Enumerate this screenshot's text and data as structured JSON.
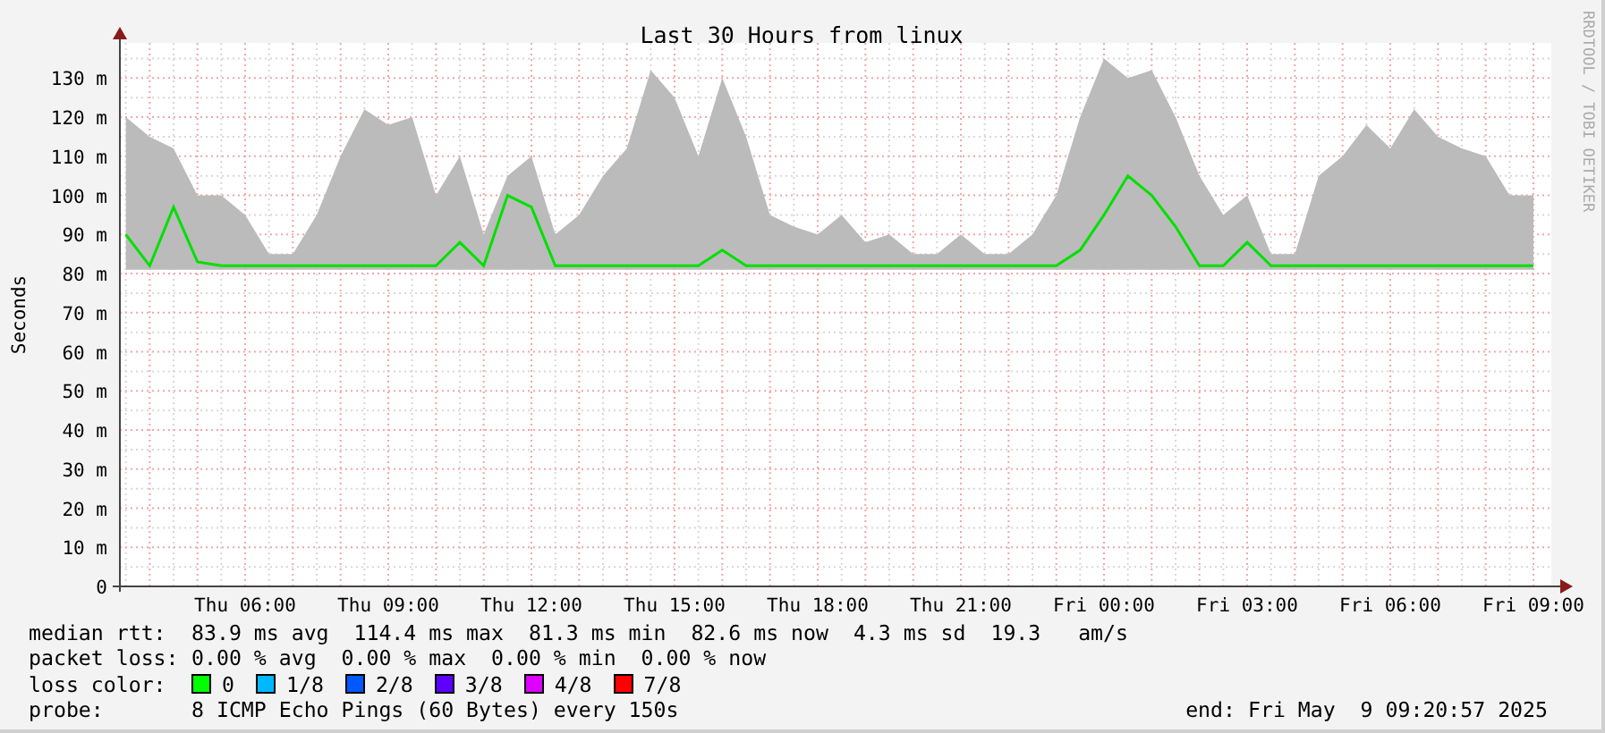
{
  "chart": {
    "watermark": "RRDTOOL / TOBI OETIKER",
    "chart_data": {
      "type": "line",
      "title": "Last 30 Hours from linux",
      "ylabel": "Seconds",
      "categories": [
        null,
        null,
        null,
        null,
        null,
        "Thu 06:00",
        null,
        null,
        null,
        null,
        null,
        "Thu 09:00",
        null,
        null,
        null,
        null,
        null,
        "Thu 12:00",
        null,
        null,
        null,
        null,
        null,
        "Thu 15:00",
        null,
        null,
        null,
        null,
        null,
        "Thu 18:00",
        null,
        null,
        null,
        null,
        null,
        "Thu 21:00",
        null,
        null,
        null,
        null,
        null,
        "Fri 00:00",
        null,
        null,
        null,
        null,
        null,
        "Fri 03:00",
        null,
        null,
        null,
        null,
        null,
        "Fri 06:00",
        null,
        null,
        null,
        null,
        null,
        "Fri 09:00"
      ],
      "ylim": [
        0,
        139
      ],
      "grid": true,
      "yticks": [
        {
          "value": 0,
          "label": "0"
        },
        {
          "value": 10,
          "label": "10 m"
        },
        {
          "value": 20,
          "label": "20 m"
        },
        {
          "value": 30,
          "label": "30 m"
        },
        {
          "value": 40,
          "label": "40 m"
        },
        {
          "value": 50,
          "label": "50 m"
        },
        {
          "value": 60,
          "label": "60 m"
        },
        {
          "value": 70,
          "label": "70 m"
        },
        {
          "value": 80,
          "label": "80 m"
        },
        {
          "value": 90,
          "label": "90 m"
        },
        {
          "value": 100,
          "label": "100 m"
        },
        {
          "value": 110,
          "label": "110 m"
        },
        {
          "value": 120,
          "label": "120 m"
        },
        {
          "value": 130,
          "label": "130 m"
        }
      ],
      "series": [
        {
          "type": "area",
          "color": "#bbbbbb",
          "values": [
            120,
            115,
            112,
            100,
            100,
            95,
            85,
            85,
            95,
            110,
            122,
            118,
            120,
            100,
            110,
            90,
            105,
            110,
            90,
            95,
            105,
            112,
            132,
            125,
            110,
            130,
            115,
            95,
            92,
            90,
            95,
            88,
            90,
            85,
            85,
            90,
            85,
            85,
            90,
            100,
            120,
            135,
            130,
            132,
            120,
            105,
            95,
            100,
            85,
            85,
            105,
            110,
            118,
            112,
            122,
            115,
            112,
            110,
            100,
            100
          ]
        },
        {
          "type": "line",
          "color": "#00e000",
          "values": [
            90,
            82,
            97,
            83,
            82,
            82,
            82,
            82,
            82,
            82,
            82,
            82,
            82,
            82,
            88,
            82,
            100,
            97,
            82,
            82,
            82,
            82,
            82,
            82,
            82,
            86,
            82,
            82,
            82,
            82,
            82,
            82,
            82,
            82,
            82,
            82,
            82,
            82,
            82,
            82,
            86,
            95,
            105,
            100,
            92,
            82,
            82,
            88,
            82,
            82,
            82,
            82,
            82,
            82,
            82,
            82,
            82,
            82,
            82,
            82
          ]
        }
      ]
    }
  },
  "legend": {
    "rows": [
      {
        "label": "median rtt:",
        "text": "83.9 ms avg  114.4 ms max  81.3 ms min  82.6 ms now  4.3 ms sd  19.3   am/s"
      },
      {
        "label": "packet loss:",
        "text": "0.00 % avg  0.00 % max  0.00 % min  0.00 % now"
      }
    ],
    "loss_color": {
      "label": "loss color:",
      "items": [
        {
          "label": "0",
          "color": "#00ff00"
        },
        {
          "label": "1/8",
          "color": "#00b8ff"
        },
        {
          "label": "2/8",
          "color": "#0059ff"
        },
        {
          "label": "3/8",
          "color": "#5e00ff"
        },
        {
          "label": "4/8",
          "color": "#dd00ff"
        },
        {
          "label": "7/8",
          "color": "#ff0000"
        }
      ]
    },
    "probe": {
      "label": "probe:",
      "text": "8 ICMP Echo Pings (60 Bytes) every 150s",
      "end": "end: Fri May  9 09:20:57 2025"
    }
  }
}
